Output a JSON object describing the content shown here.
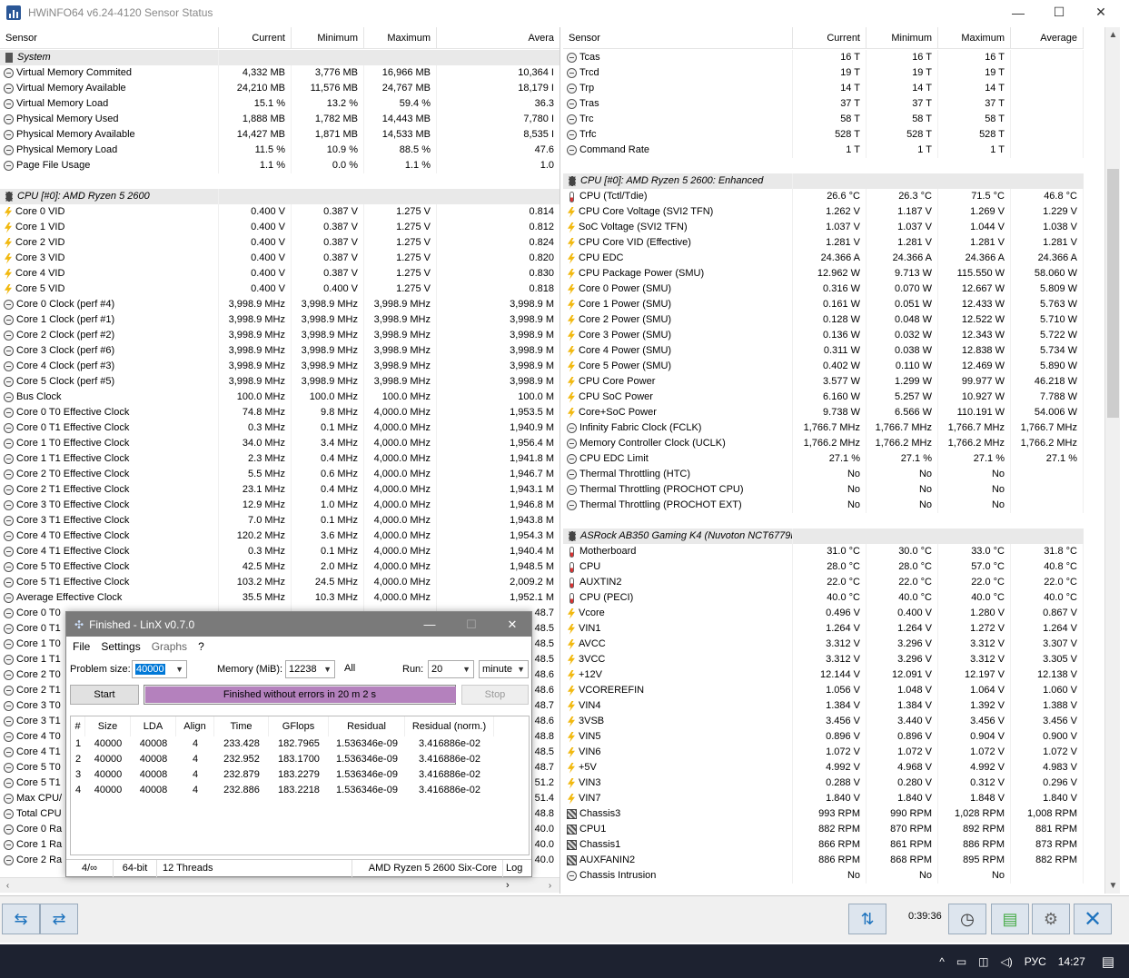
{
  "window": {
    "title": "HWiNFO64 v6.24-4120 Sensor Status",
    "minimize": "—",
    "maximize": "☐",
    "close": "✕"
  },
  "left_headers": [
    "Sensor",
    "Current",
    "Minimum",
    "Maximum",
    "Avera"
  ],
  "right_headers": [
    "Sensor",
    "Current",
    "Minimum",
    "Maximum",
    "Average"
  ],
  "left_rows": [
    {
      "type": "group",
      "icon": "system-icon",
      "name": "System"
    },
    {
      "icon": "clock-icon",
      "name": "Virtual Memory Commited",
      "cur": "4,332 MB",
      "min": "3,776 MB",
      "max": "16,966 MB",
      "avg": "10,364 I"
    },
    {
      "icon": "clock-icon",
      "name": "Virtual Memory Available",
      "cur": "24,210 MB",
      "min": "11,576 MB",
      "max": "24,767 MB",
      "avg": "18,179 I"
    },
    {
      "icon": "clock-icon",
      "name": "Virtual Memory Load",
      "cur": "15.1 %",
      "min": "13.2 %",
      "max": "59.4 %",
      "avg": "36.3"
    },
    {
      "icon": "clock-icon",
      "name": "Physical Memory Used",
      "cur": "1,888 MB",
      "min": "1,782 MB",
      "max": "14,443 MB",
      "avg": "7,780 I"
    },
    {
      "icon": "clock-icon",
      "name": "Physical Memory Available",
      "cur": "14,427 MB",
      "min": "1,871 MB",
      "max": "14,533 MB",
      "avg": "8,535 I"
    },
    {
      "icon": "clock-icon",
      "name": "Physical Memory Load",
      "cur": "11.5 %",
      "min": "10.9 %",
      "max": "88.5 %",
      "avg": "47.6"
    },
    {
      "icon": "clock-icon",
      "name": "Page File Usage",
      "cur": "1.1 %",
      "min": "0.0 %",
      "max": "1.1 %",
      "avg": "1.0"
    },
    {
      "type": "blank"
    },
    {
      "type": "group",
      "icon": "chip-icon",
      "name": "CPU [#0]: AMD Ryzen 5 2600"
    },
    {
      "icon": "voltage-icon",
      "name": "Core 0 VID",
      "cur": "0.400 V",
      "min": "0.387 V",
      "max": "1.275 V",
      "avg": "0.814"
    },
    {
      "icon": "voltage-icon",
      "name": "Core 1 VID",
      "cur": "0.400 V",
      "min": "0.387 V",
      "max": "1.275 V",
      "avg": "0.812"
    },
    {
      "icon": "voltage-icon",
      "name": "Core 2 VID",
      "cur": "0.400 V",
      "min": "0.387 V",
      "max": "1.275 V",
      "avg": "0.824"
    },
    {
      "icon": "voltage-icon",
      "name": "Core 3 VID",
      "cur": "0.400 V",
      "min": "0.387 V",
      "max": "1.275 V",
      "avg": "0.820"
    },
    {
      "icon": "voltage-icon",
      "name": "Core 4 VID",
      "cur": "0.400 V",
      "min": "0.387 V",
      "max": "1.275 V",
      "avg": "0.830"
    },
    {
      "icon": "voltage-icon",
      "name": "Core 5 VID",
      "cur": "0.400 V",
      "min": "0.400 V",
      "max": "1.275 V",
      "avg": "0.818"
    },
    {
      "icon": "clock-icon",
      "name": "Core 0 Clock (perf #4)",
      "cur": "3,998.9 MHz",
      "min": "3,998.9 MHz",
      "max": "3,998.9 MHz",
      "avg": "3,998.9 M"
    },
    {
      "icon": "clock-icon",
      "name": "Core 1 Clock (perf #1)",
      "cur": "3,998.9 MHz",
      "min": "3,998.9 MHz",
      "max": "3,998.9 MHz",
      "avg": "3,998.9 M"
    },
    {
      "icon": "clock-icon",
      "name": "Core 2 Clock (perf #2)",
      "cur": "3,998.9 MHz",
      "min": "3,998.9 MHz",
      "max": "3,998.9 MHz",
      "avg": "3,998.9 M"
    },
    {
      "icon": "clock-icon",
      "name": "Core 3 Clock (perf #6)",
      "cur": "3,998.9 MHz",
      "min": "3,998.9 MHz",
      "max": "3,998.9 MHz",
      "avg": "3,998.9 M"
    },
    {
      "icon": "clock-icon",
      "name": "Core 4 Clock (perf #3)",
      "cur": "3,998.9 MHz",
      "min": "3,998.9 MHz",
      "max": "3,998.9 MHz",
      "avg": "3,998.9 M"
    },
    {
      "icon": "clock-icon",
      "name": "Core 5 Clock (perf #5)",
      "cur": "3,998.9 MHz",
      "min": "3,998.9 MHz",
      "max": "3,998.9 MHz",
      "avg": "3,998.9 M"
    },
    {
      "icon": "clock-icon",
      "name": "Bus Clock",
      "cur": "100.0 MHz",
      "min": "100.0 MHz",
      "max": "100.0 MHz",
      "avg": "100.0 M"
    },
    {
      "icon": "clock-icon",
      "name": "Core 0 T0 Effective Clock",
      "cur": "74.8 MHz",
      "min": "9.8 MHz",
      "max": "4,000.0 MHz",
      "avg": "1,953.5 M"
    },
    {
      "icon": "clock-icon",
      "name": "Core 0 T1 Effective Clock",
      "cur": "0.3 MHz",
      "min": "0.1 MHz",
      "max": "4,000.0 MHz",
      "avg": "1,940.9 M"
    },
    {
      "icon": "clock-icon",
      "name": "Core 1 T0 Effective Clock",
      "cur": "34.0 MHz",
      "min": "3.4 MHz",
      "max": "4,000.0 MHz",
      "avg": "1,956.4 M"
    },
    {
      "icon": "clock-icon",
      "name": "Core 1 T1 Effective Clock",
      "cur": "2.3 MHz",
      "min": "0.4 MHz",
      "max": "4,000.0 MHz",
      "avg": "1,941.8 M"
    },
    {
      "icon": "clock-icon",
      "name": "Core 2 T0 Effective Clock",
      "cur": "5.5 MHz",
      "min": "0.6 MHz",
      "max": "4,000.0 MHz",
      "avg": "1,946.7 M"
    },
    {
      "icon": "clock-icon",
      "name": "Core 2 T1 Effective Clock",
      "cur": "23.1 MHz",
      "min": "0.4 MHz",
      "max": "4,000.0 MHz",
      "avg": "1,943.1 M"
    },
    {
      "icon": "clock-icon",
      "name": "Core 3 T0 Effective Clock",
      "cur": "12.9 MHz",
      "min": "1.0 MHz",
      "max": "4,000.0 MHz",
      "avg": "1,946.8 M"
    },
    {
      "icon": "clock-icon",
      "name": "Core 3 T1 Effective Clock",
      "cur": "7.0 MHz",
      "min": "0.1 MHz",
      "max": "4,000.0 MHz",
      "avg": "1,943.8 M"
    },
    {
      "icon": "clock-icon",
      "name": "Core 4 T0 Effective Clock",
      "cur": "120.2 MHz",
      "min": "3.6 MHz",
      "max": "4,000.0 MHz",
      "avg": "1,954.3 M"
    },
    {
      "icon": "clock-icon",
      "name": "Core 4 T1 Effective Clock",
      "cur": "0.3 MHz",
      "min": "0.1 MHz",
      "max": "4,000.0 MHz",
      "avg": "1,940.4 M"
    },
    {
      "icon": "clock-icon",
      "name": "Core 5 T0 Effective Clock",
      "cur": "42.5 MHz",
      "min": "2.0 MHz",
      "max": "4,000.0 MHz",
      "avg": "1,948.5 M"
    },
    {
      "icon": "clock-icon",
      "name": "Core 5 T1 Effective Clock",
      "cur": "103.2 MHz",
      "min": "24.5 MHz",
      "max": "4,000.0 MHz",
      "avg": "2,009.2 M"
    },
    {
      "icon": "clock-icon",
      "name": "Average Effective Clock",
      "cur": "35.5 MHz",
      "min": "10.3 MHz",
      "max": "4,000.0 MHz",
      "avg": "1,952.1 M"
    },
    {
      "icon": "clock-icon",
      "name": "Core 0 T0",
      "cur": "",
      "min": "",
      "max": "",
      "avg": "48.7"
    },
    {
      "icon": "clock-icon",
      "name": "Core 0 T1",
      "cur": "",
      "min": "",
      "max": "",
      "avg": "48.5"
    },
    {
      "icon": "clock-icon",
      "name": "Core 1 T0",
      "cur": "",
      "min": "",
      "max": "",
      "avg": "48.5"
    },
    {
      "icon": "clock-icon",
      "name": "Core 1 T1",
      "cur": "",
      "min": "",
      "max": "",
      "avg": "48.5"
    },
    {
      "icon": "clock-icon",
      "name": "Core 2 T0",
      "cur": "",
      "min": "",
      "max": "",
      "avg": "48.6"
    },
    {
      "icon": "clock-icon",
      "name": "Core 2 T1",
      "cur": "",
      "min": "",
      "max": "",
      "avg": "48.6"
    },
    {
      "icon": "clock-icon",
      "name": "Core 3 T0",
      "cur": "",
      "min": "",
      "max": "",
      "avg": "48.7"
    },
    {
      "icon": "clock-icon",
      "name": "Core 3 T1",
      "cur": "",
      "min": "",
      "max": "",
      "avg": "48.6"
    },
    {
      "icon": "clock-icon",
      "name": "Core 4 T0",
      "cur": "",
      "min": "",
      "max": "",
      "avg": "48.8"
    },
    {
      "icon": "clock-icon",
      "name": "Core 4 T1",
      "cur": "",
      "min": "",
      "max": "",
      "avg": "48.5"
    },
    {
      "icon": "clock-icon",
      "name": "Core 5 T0",
      "cur": "",
      "min": "",
      "max": "",
      "avg": "48.7"
    },
    {
      "icon": "clock-icon",
      "name": "Core 5 T1",
      "cur": "",
      "min": "",
      "max": "",
      "avg": "51.2"
    },
    {
      "icon": "clock-icon",
      "name": "Max CPU/",
      "cur": "",
      "min": "",
      "max": "",
      "avg": "51.4"
    },
    {
      "icon": "clock-icon",
      "name": "Total CPU",
      "cur": "",
      "min": "",
      "max": "",
      "avg": "48.8"
    },
    {
      "icon": "clock-icon",
      "name": "Core 0 Ra",
      "cur": "",
      "min": "",
      "max": "",
      "avg": "40.0"
    },
    {
      "icon": "clock-icon",
      "name": "Core 1 Ra",
      "cur": "",
      "min": "",
      "max": "",
      "avg": "40.0"
    },
    {
      "icon": "clock-icon",
      "name": "Core 2 Ra",
      "cur": "",
      "min": "",
      "max": "",
      "avg": "40.0"
    }
  ],
  "right_rows": [
    {
      "icon": "clock-icon",
      "name": "Tcas",
      "cur": "16 T",
      "min": "16 T",
      "max": "16 T",
      "avg": ""
    },
    {
      "icon": "clock-icon",
      "name": "Trcd",
      "cur": "19 T",
      "min": "19 T",
      "max": "19 T",
      "avg": ""
    },
    {
      "icon": "clock-icon",
      "name": "Trp",
      "cur": "14 T",
      "min": "14 T",
      "max": "14 T",
      "avg": ""
    },
    {
      "icon": "clock-icon",
      "name": "Tras",
      "cur": "37 T",
      "min": "37 T",
      "max": "37 T",
      "avg": ""
    },
    {
      "icon": "clock-icon",
      "name": "Trc",
      "cur": "58 T",
      "min": "58 T",
      "max": "58 T",
      "avg": ""
    },
    {
      "icon": "clock-icon",
      "name": "Trfc",
      "cur": "528 T",
      "min": "528 T",
      "max": "528 T",
      "avg": ""
    },
    {
      "icon": "clock-icon",
      "name": "Command Rate",
      "cur": "1 T",
      "min": "1 T",
      "max": "1 T",
      "avg": ""
    },
    {
      "type": "blank"
    },
    {
      "type": "group",
      "icon": "chip-icon",
      "name": "CPU [#0]: AMD Ryzen 5 2600: Enhanced"
    },
    {
      "icon": "thermometer-icon",
      "name": "CPU (Tctl/Tdie)",
      "cur": "26.6 °C",
      "min": "26.3 °C",
      "max": "71.5 °C",
      "avg": "46.8 °C"
    },
    {
      "icon": "voltage-icon",
      "name": "CPU Core Voltage (SVI2 TFN)",
      "cur": "1.262 V",
      "min": "1.187 V",
      "max": "1.269 V",
      "avg": "1.229 V"
    },
    {
      "icon": "voltage-icon",
      "name": "SoC Voltage (SVI2 TFN)",
      "cur": "1.037 V",
      "min": "1.037 V",
      "max": "1.044 V",
      "avg": "1.038 V"
    },
    {
      "icon": "voltage-icon",
      "name": "CPU Core VID (Effective)",
      "cur": "1.281 V",
      "min": "1.281 V",
      "max": "1.281 V",
      "avg": "1.281 V"
    },
    {
      "icon": "voltage-icon",
      "name": "CPU EDC",
      "cur": "24.366 A",
      "min": "24.366 A",
      "max": "24.366 A",
      "avg": "24.366 A"
    },
    {
      "icon": "voltage-icon",
      "name": "CPU Package Power (SMU)",
      "cur": "12.962 W",
      "min": "9.713 W",
      "max": "115.550 W",
      "avg": "58.060 W"
    },
    {
      "icon": "voltage-icon",
      "name": "Core 0 Power (SMU)",
      "cur": "0.316 W",
      "min": "0.070 W",
      "max": "12.667 W",
      "avg": "5.809 W"
    },
    {
      "icon": "voltage-icon",
      "name": "Core 1 Power (SMU)",
      "cur": "0.161 W",
      "min": "0.051 W",
      "max": "12.433 W",
      "avg": "5.763 W"
    },
    {
      "icon": "voltage-icon",
      "name": "Core 2 Power (SMU)",
      "cur": "0.128 W",
      "min": "0.048 W",
      "max": "12.522 W",
      "avg": "5.710 W"
    },
    {
      "icon": "voltage-icon",
      "name": "Core 3 Power (SMU)",
      "cur": "0.136 W",
      "min": "0.032 W",
      "max": "12.343 W",
      "avg": "5.722 W"
    },
    {
      "icon": "voltage-icon",
      "name": "Core 4 Power (SMU)",
      "cur": "0.311 W",
      "min": "0.038 W",
      "max": "12.838 W",
      "avg": "5.734 W"
    },
    {
      "icon": "voltage-icon",
      "name": "Core 5 Power (SMU)",
      "cur": "0.402 W",
      "min": "0.110 W",
      "max": "12.469 W",
      "avg": "5.890 W"
    },
    {
      "icon": "voltage-icon",
      "name": "CPU Core Power",
      "cur": "3.577 W",
      "min": "1.299 W",
      "max": "99.977 W",
      "avg": "46.218 W"
    },
    {
      "icon": "voltage-icon",
      "name": "CPU SoC Power",
      "cur": "6.160 W",
      "min": "5.257 W",
      "max": "10.927 W",
      "avg": "7.788 W"
    },
    {
      "icon": "voltage-icon",
      "name": "Core+SoC Power",
      "cur": "9.738 W",
      "min": "6.566 W",
      "max": "110.191 W",
      "avg": "54.006 W"
    },
    {
      "icon": "clock-icon",
      "name": "Infinity Fabric Clock (FCLK)",
      "cur": "1,766.7 MHz",
      "min": "1,766.7 MHz",
      "max": "1,766.7 MHz",
      "avg": "1,766.7 MHz"
    },
    {
      "icon": "clock-icon",
      "name": "Memory Controller Clock (UCLK)",
      "cur": "1,766.2 MHz",
      "min": "1,766.2 MHz",
      "max": "1,766.2 MHz",
      "avg": "1,766.2 MHz"
    },
    {
      "icon": "clock-icon",
      "name": "CPU EDC Limit",
      "cur": "27.1 %",
      "min": "27.1 %",
      "max": "27.1 %",
      "avg": "27.1 %"
    },
    {
      "icon": "clock-icon",
      "name": "Thermal Throttling (HTC)",
      "cur": "No",
      "min": "No",
      "max": "No",
      "avg": ""
    },
    {
      "icon": "clock-icon",
      "name": "Thermal Throttling (PROCHOT CPU)",
      "cur": "No",
      "min": "No",
      "max": "No",
      "avg": ""
    },
    {
      "icon": "clock-icon",
      "name": "Thermal Throttling (PROCHOT EXT)",
      "cur": "No",
      "min": "No",
      "max": "No",
      "avg": ""
    },
    {
      "type": "blank"
    },
    {
      "type": "group",
      "icon": "chip-icon",
      "name": "ASRock AB350 Gaming K4 (Nuvoton NCT6779D)"
    },
    {
      "icon": "thermometer-icon",
      "name": "Motherboard",
      "cur": "31.0 °C",
      "min": "30.0 °C",
      "max": "33.0 °C",
      "avg": "31.8 °C"
    },
    {
      "icon": "thermometer-icon",
      "name": "CPU",
      "cur": "28.0 °C",
      "min": "28.0 °C",
      "max": "57.0 °C",
      "avg": "40.8 °C"
    },
    {
      "icon": "thermometer-icon",
      "name": "AUXTIN2",
      "cur": "22.0 °C",
      "min": "22.0 °C",
      "max": "22.0 °C",
      "avg": "22.0 °C"
    },
    {
      "icon": "thermometer-icon",
      "name": "CPU (PECI)",
      "cur": "40.0 °C",
      "min": "40.0 °C",
      "max": "40.0 °C",
      "avg": "40.0 °C"
    },
    {
      "icon": "voltage-icon",
      "name": "Vcore",
      "cur": "0.496 V",
      "min": "0.400 V",
      "max": "1.280 V",
      "avg": "0.867 V"
    },
    {
      "icon": "voltage-icon",
      "name": "VIN1",
      "cur": "1.264 V",
      "min": "1.264 V",
      "max": "1.272 V",
      "avg": "1.264 V"
    },
    {
      "icon": "voltage-icon",
      "name": "AVCC",
      "cur": "3.312 V",
      "min": "3.296 V",
      "max": "3.312 V",
      "avg": "3.307 V"
    },
    {
      "icon": "voltage-icon",
      "name": "3VCC",
      "cur": "3.312 V",
      "min": "3.296 V",
      "max": "3.312 V",
      "avg": "3.305 V"
    },
    {
      "icon": "voltage-icon",
      "name": "+12V",
      "cur": "12.144 V",
      "min": "12.091 V",
      "max": "12.197 V",
      "avg": "12.138 V"
    },
    {
      "icon": "voltage-icon",
      "name": "VCOREREFIN",
      "cur": "1.056 V",
      "min": "1.048 V",
      "max": "1.064 V",
      "avg": "1.060 V"
    },
    {
      "icon": "voltage-icon",
      "name": "VIN4",
      "cur": "1.384 V",
      "min": "1.384 V",
      "max": "1.392 V",
      "avg": "1.388 V"
    },
    {
      "icon": "voltage-icon",
      "name": "3VSB",
      "cur": "3.456 V",
      "min": "3.440 V",
      "max": "3.456 V",
      "avg": "3.456 V"
    },
    {
      "icon": "voltage-icon",
      "name": "VIN5",
      "cur": "0.896 V",
      "min": "0.896 V",
      "max": "0.904 V",
      "avg": "0.900 V"
    },
    {
      "icon": "voltage-icon",
      "name": "VIN6",
      "cur": "1.072 V",
      "min": "1.072 V",
      "max": "1.072 V",
      "avg": "1.072 V"
    },
    {
      "icon": "voltage-icon",
      "name": "+5V",
      "cur": "4.992 V",
      "min": "4.968 V",
      "max": "4.992 V",
      "avg": "4.983 V"
    },
    {
      "icon": "voltage-icon",
      "name": "VIN3",
      "cur": "0.288 V",
      "min": "0.280 V",
      "max": "0.312 V",
      "avg": "0.296 V"
    },
    {
      "icon": "voltage-icon",
      "name": "VIN7",
      "cur": "1.840 V",
      "min": "1.840 V",
      "max": "1.848 V",
      "avg": "1.840 V"
    },
    {
      "icon": "fan-icon",
      "name": "Chassis3",
      "cur": "993 RPM",
      "min": "990 RPM",
      "max": "1,028 RPM",
      "avg": "1,008 RPM"
    },
    {
      "icon": "fan-icon",
      "name": "CPU1",
      "cur": "882 RPM",
      "min": "870 RPM",
      "max": "892 RPM",
      "avg": "881 RPM"
    },
    {
      "icon": "fan-icon",
      "name": "Chassis1",
      "cur": "866 RPM",
      "min": "861 RPM",
      "max": "886 RPM",
      "avg": "873 RPM"
    },
    {
      "icon": "fan-icon",
      "name": "AUXFANIN2",
      "cur": "886 RPM",
      "min": "868 RPM",
      "max": "895 RPM",
      "avg": "882 RPM"
    },
    {
      "icon": "clock-icon",
      "name": "Chassis Intrusion",
      "cur": "No",
      "min": "No",
      "max": "No",
      "avg": ""
    }
  ],
  "toolbar": {
    "timer": "0:39:36"
  },
  "taskbar": {
    "language": "РУС",
    "time": "14:27",
    "chevron": "^"
  },
  "linx": {
    "title": "Finished - LinX v0.7.0",
    "minimize": "—",
    "maximize": "☐",
    "close": "✕",
    "menu": [
      "File",
      "Settings",
      "Graphs",
      "?"
    ],
    "problem_size_label": "Problem size:",
    "problem_size": "40000",
    "memory_label": "Memory (MiB):",
    "memory": "12238",
    "all_label": "All",
    "run_label": "Run:",
    "run": "20",
    "run_unit": "minute",
    "start": "Start",
    "stop": "Stop",
    "progress_text": "Finished without errors in 20 m 2 s",
    "progress": 1.0,
    "columns": [
      "#",
      "Size",
      "LDA",
      "Align",
      "Time",
      "GFlops",
      "Residual",
      "Residual (norm.)"
    ],
    "rows": [
      [
        "1",
        "40000",
        "40008",
        "4",
        "233.428",
        "182.7965",
        "1.536346e-09",
        "3.416886e-02"
      ],
      [
        "2",
        "40000",
        "40008",
        "4",
        "232.952",
        "183.1700",
        "1.536346e-09",
        "3.416886e-02"
      ],
      [
        "3",
        "40000",
        "40008",
        "4",
        "232.879",
        "183.2279",
        "1.536346e-09",
        "3.416886e-02"
      ],
      [
        "4",
        "40000",
        "40008",
        "4",
        "232.886",
        "183.2218",
        "1.536346e-09",
        "3.416886e-02"
      ]
    ],
    "status": [
      "4/∞",
      "64-bit",
      "12 Threads",
      "AMD Ryzen 5 2600 Six-Core",
      "Log ›"
    ]
  }
}
